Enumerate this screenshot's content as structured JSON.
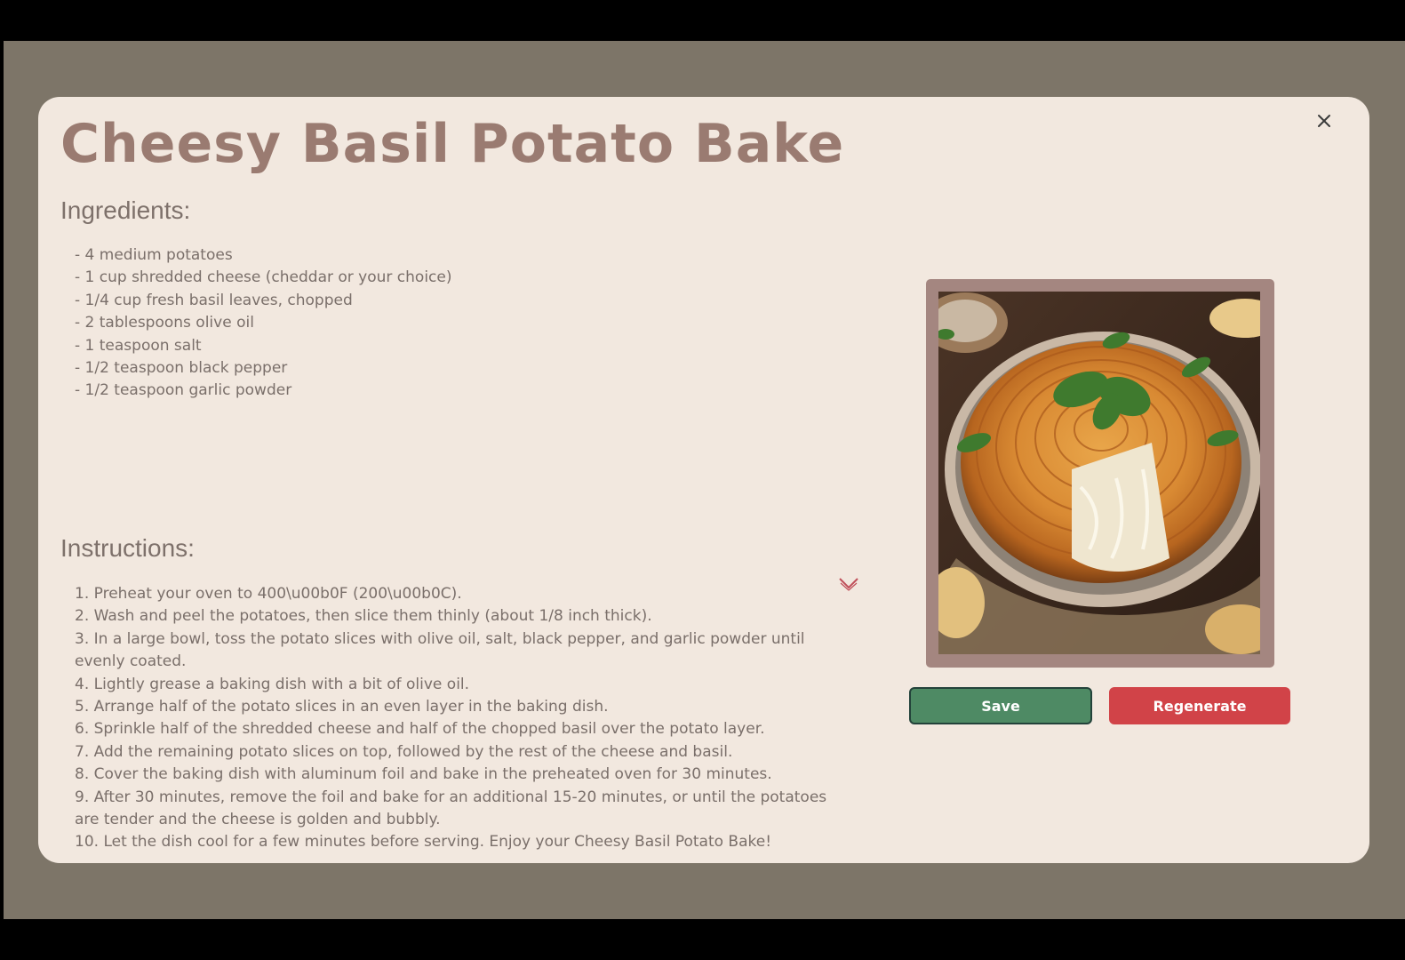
{
  "recipe": {
    "title": "Cheesy Basil Potato Bake",
    "ingredients_heading": "Ingredients:",
    "ingredients": [
      "- 4 medium potatoes",
      "- 1 cup shredded cheese (cheddar or your choice)",
      "- 1/4 cup fresh basil leaves, chopped",
      "- 2 tablespoons olive oil",
      "- 1 teaspoon salt",
      "- 1/2 teaspoon black pepper",
      "- 1/2 teaspoon garlic powder"
    ],
    "instructions_heading": "Instructions:",
    "instructions": [
      "1. Preheat your oven to 400\\u00b0F (200\\u00b0C).",
      "2. Wash and peel the potatoes, then slice them thinly (about 1/8 inch thick).",
      "3. In a large bowl, toss the potato slices with olive oil, salt, black pepper, and garlic powder until evenly coated.",
      "4. Lightly grease a baking dish with a bit of olive oil.",
      "5. Arrange half of the potato slices in an even layer in the baking dish.",
      "6. Sprinkle half of the shredded cheese and half of the chopped basil over the potato layer.",
      "7. Add the remaining potato slices on top, followed by the rest of the cheese and basil.",
      "8. Cover the baking dish with aluminum foil and bake in the preheated oven for 30 minutes.",
      "9. After 30 minutes, remove the foil and bake for an additional 15-20 minutes, or until the potatoes are tender and the cheese is golden and bubbly.",
      "10. Let the dish cool for a few minutes before serving. Enjoy your Cheesy Basil Potato Bake!"
    ]
  },
  "actions": {
    "save_label": "Save",
    "regenerate_label": "Regenerate"
  },
  "icons": {
    "close": "close-icon",
    "chevron": "chevron-down-icon"
  },
  "colors": {
    "overlay": "#7d7568",
    "modal_background": "#f2e8df",
    "title": "#9a7b71",
    "photo_frame": "#a48680",
    "save_button": "#4e8a64",
    "regenerate_button": "#d14348"
  }
}
